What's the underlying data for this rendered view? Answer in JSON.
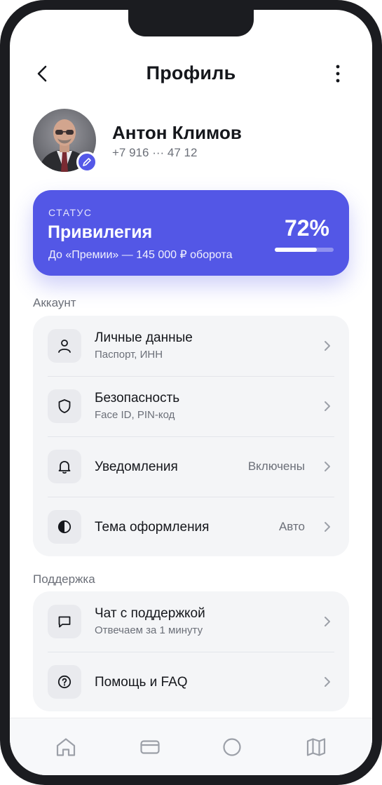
{
  "header": {
    "title": "Профиль"
  },
  "profile": {
    "name": "Антон Климов",
    "phone": "+7 916 ··· 47 12"
  },
  "status": {
    "label": "СТАТУС",
    "name": "Привилегия",
    "hint": "До «Премии» — 145 000 ₽ оборота",
    "percent_text": "72%",
    "progress": 0.72,
    "color": "#5357e6"
  },
  "account": {
    "title": "Аккаунт",
    "items": [
      {
        "icon": "user-icon",
        "title": "Личные данные",
        "subtitle": "Паспорт, ИНН"
      },
      {
        "icon": "shield-icon",
        "title": "Безопасность",
        "subtitle": "Face ID, PIN-код"
      },
      {
        "icon": "bell-icon",
        "title": "Уведомления",
        "value": "Включены"
      },
      {
        "icon": "theme-icon",
        "title": "Тема оформления",
        "value": "Авто"
      }
    ]
  },
  "support": {
    "title": "Поддержка",
    "items": [
      {
        "icon": "chat-icon",
        "title": "Чат с поддержкой",
        "subtitle": "Отвечаем за 1 минуту"
      },
      {
        "icon": "help-icon",
        "title": "Помощь и FAQ"
      }
    ]
  },
  "bottom_nav": {
    "items": [
      "home-icon",
      "card-icon",
      "circle-icon",
      "map-icon"
    ],
    "active_color": "#5357e6",
    "inactive_color": "#9ca0a8"
  }
}
